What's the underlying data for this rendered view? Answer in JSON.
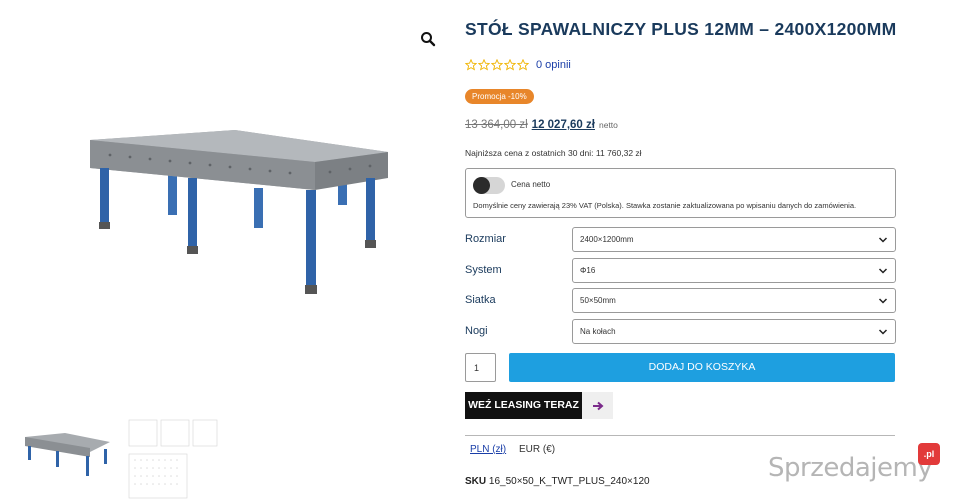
{
  "product": {
    "title": "STÓŁ SPAWALNICZY PLUS 12MM – 2400X1200MM",
    "review_link": "0 opinii",
    "rating": 0,
    "rating_max": 5,
    "promo_badge": "Promocja -10%",
    "old_price": "13 364,00 zł",
    "new_price": "12 027,60 zł",
    "price_suffix": "netto",
    "lowest_price_note": "Najniższa cena z ostatnich 30 dni: 11 760,32 zł"
  },
  "netto_toggle": {
    "label": "Cena netto",
    "vat_note": "Domyślnie ceny zawierają 23% VAT (Polska). Stawka zostanie zaktualizowana po wpisaniu danych do zamówienia."
  },
  "options": [
    {
      "label": "Rozmiar",
      "value": "2400×1200mm"
    },
    {
      "label": "System",
      "value": "Φ16"
    },
    {
      "label": "Siatka",
      "value": "50×50mm"
    },
    {
      "label": "Nogi",
      "value": "Na kołach"
    }
  ],
  "cart": {
    "quantity": "1",
    "add_label": "DODAJ DO KOSZYKA"
  },
  "leasing": {
    "label": "WEŹ LEASING TERAZ"
  },
  "currency": {
    "pln": "PLN (zł)",
    "eur": "EUR (€)"
  },
  "sku": {
    "label": "SKU",
    "value": "16_50×50_K_TWT_PLUS_240×120"
  },
  "watermark": {
    "text": "Sprzedajemy",
    "badge": ".pl"
  },
  "colors": {
    "title": "#1a3a5c",
    "promo": "#e8862a",
    "add_to_cart": "#1e9fe0",
    "star": "#f0b400",
    "link": "#1a3ea8",
    "leasing_arrow": "#7a2a8a"
  },
  "icons": {
    "zoom": "search-icon",
    "star": "star-outline-icon",
    "chevron": "chevron-down-icon",
    "leasing": "arrow-right-icon"
  }
}
